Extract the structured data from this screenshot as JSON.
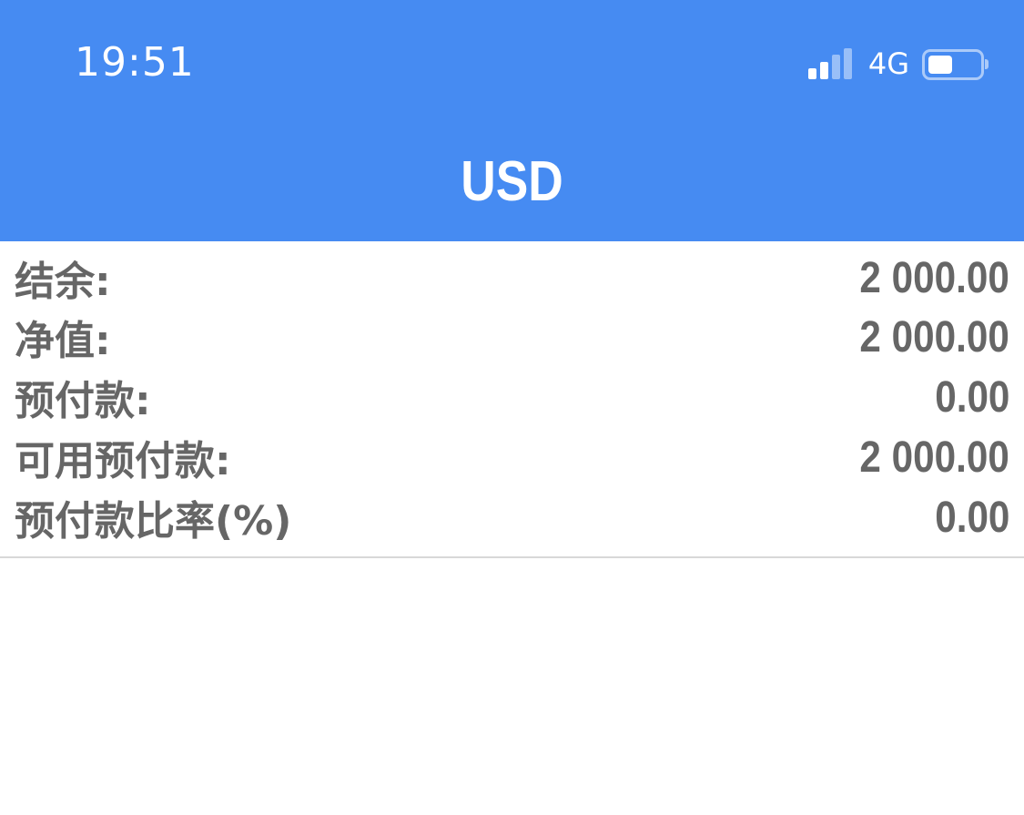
{
  "status_bar": {
    "time": "19:51",
    "network": "4G",
    "signal_level": 0.5,
    "battery_level": 0.5
  },
  "header": {
    "title": "USD"
  },
  "account": {
    "rows": [
      {
        "label": "结余:",
        "value": "2 000.00"
      },
      {
        "label": "净值:",
        "value": "2 000.00"
      },
      {
        "label": "预付款:",
        "value": "0.00"
      },
      {
        "label": "可用预付款:",
        "value": "2 000.00"
      },
      {
        "label": "预付款比率(%)",
        "value": "0.00"
      }
    ]
  },
  "colors": {
    "header_bg": "#468bf2",
    "text": "#666666",
    "divider": "#d8d8d8"
  }
}
